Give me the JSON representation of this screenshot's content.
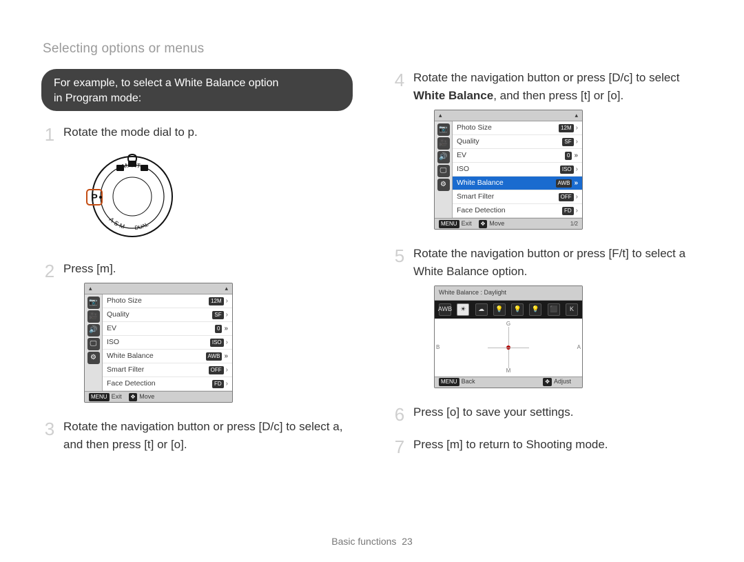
{
  "page_title": "Selecting options or menus",
  "example_box": {
    "line1": "For example, to select a White Balance option",
    "line2": "in Program mode:"
  },
  "steps_left": [
    {
      "text_parts": [
        "Rotate the mode dial to ",
        "p",
        "."
      ],
      "bold_indices": []
    },
    {
      "text_parts": [
        "Press [",
        "m",
        "]."
      ],
      "bold_indices": []
    },
    {
      "text_parts": [
        "Rotate the navigation button or press [",
        "D",
        "/",
        "c",
        "] to select ",
        "a",
        ", and then press [",
        "t",
        "] or [",
        "o",
        "]."
      ],
      "bold_indices": []
    }
  ],
  "steps_right": [
    {
      "prefix": "Rotate the navigation button or press [",
      "k1": "D",
      "mid": "/",
      "k2": "c",
      "after_keys": "] to select ",
      "bold": "White Balance",
      "after_bold": ", and then press [",
      "k3": "t",
      "or": "] or [",
      "k4": "o",
      "end": "]."
    },
    {
      "prefix": "Rotate the navigation button or press [",
      "k1": "F",
      "mid": "/",
      "k2": "t",
      "after_keys": "] to select a White Balance option.",
      "bold": "",
      "after_bold": "",
      "k3": "",
      "or": "",
      "k4": "",
      "end": ""
    },
    {
      "text": "Press [o] to save your settings."
    },
    {
      "text": "Press [m] to return to Shooting mode."
    }
  ],
  "menu_screen": {
    "sidebar_icons": [
      "camera-icon",
      "video-icon",
      "sound-icon",
      "display-icon",
      "gear-icon"
    ],
    "sidebar_glyphs": [
      "📷",
      "🎥",
      "🔊",
      "🖵",
      "⚙"
    ],
    "rows": [
      {
        "label": "Photo Size",
        "value": "12M",
        "chev": "single"
      },
      {
        "label": "Quality",
        "value": "SF",
        "chev": "single"
      },
      {
        "label": "EV",
        "value": "0",
        "chev": "double"
      },
      {
        "label": "ISO",
        "value": "ISO",
        "chev": "single"
      },
      {
        "label": "White Balance",
        "value": "AWB",
        "chev": "double"
      },
      {
        "label": "Smart Filter",
        "value": "OFF",
        "chev": "single"
      },
      {
        "label": "Face Detection",
        "value": "FD",
        "chev": "single"
      }
    ],
    "footer": {
      "exit": "Exit",
      "move": "Move",
      "menu_key": "MENU",
      "nav_key": "✥",
      "page": ""
    },
    "footer2_page": "1/2"
  },
  "wb_screen": {
    "title": "White Balance : Daylight",
    "options": [
      "AWB",
      "☀",
      "☁",
      "💡",
      "💡",
      "💡",
      "⬛",
      "K"
    ],
    "selected_index": 1,
    "axes": {
      "n": "G",
      "s": "M",
      "w": "B",
      "e": "A"
    },
    "footer": {
      "back": "Back",
      "adjust": "Adjust",
      "menu_key": "MENU",
      "nav_key": "✥"
    }
  },
  "mode_dial": {
    "highlight": "P",
    "labels": {
      "top": "SMART",
      "left": "P",
      "right": "",
      "bl": "A·S·M",
      "br": "DUAL"
    }
  },
  "footer": {
    "section": "Basic functions",
    "page": "23"
  }
}
